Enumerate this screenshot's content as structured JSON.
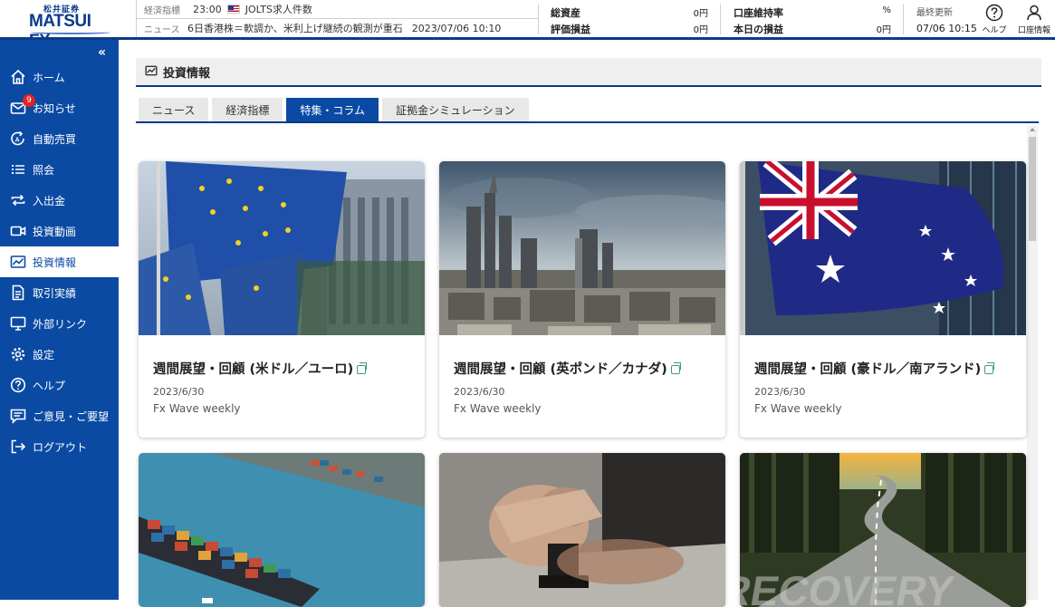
{
  "brand": {
    "top": "松井証券",
    "name": "MATSUI FX"
  },
  "ticker": {
    "row1": {
      "label": "経済指標",
      "time": "23:00",
      "text": "JOLTS求人件数"
    },
    "row2": {
      "label": "ニュース",
      "text": "6日香港株＝軟調か、米利上げ継続の観測が重石",
      "timestamp": "2023/07/06 10:10"
    }
  },
  "stats": {
    "total_assets": {
      "label": "総資産",
      "value": "0円"
    },
    "valuation": {
      "label": "評価損益",
      "value": "0円"
    },
    "margin_rate": {
      "label": "口座維持率",
      "value": "%"
    },
    "today_pl": {
      "label": "本日の損益",
      "value": "0円"
    }
  },
  "last_update": {
    "label": "最終更新",
    "time": "07/06 10:15"
  },
  "header_buttons": {
    "help": "ヘルプ",
    "account": "口座情報"
  },
  "sidebar": {
    "collapse": "«",
    "badge": "9",
    "items": [
      {
        "label": "ホーム"
      },
      {
        "label": "お知らせ"
      },
      {
        "label": "自動売買"
      },
      {
        "label": "照会"
      },
      {
        "label": "入出金"
      },
      {
        "label": "投資動画"
      },
      {
        "label": "投資情報"
      },
      {
        "label": "取引実績"
      },
      {
        "label": "外部リンク"
      },
      {
        "label": "設定"
      },
      {
        "label": "ヘルプ"
      },
      {
        "label": "ご意見・ご要望"
      },
      {
        "label": "ログアウト"
      }
    ]
  },
  "page": {
    "title": "投資情報"
  },
  "tabs": [
    {
      "label": "ニュース"
    },
    {
      "label": "経済指標"
    },
    {
      "label": "特集・コラム"
    },
    {
      "label": "証拠金シミュレーション"
    }
  ],
  "cards": [
    {
      "title": "週間展望・回顧 (米ドル／ユーロ)",
      "date": "2023/6/30",
      "source": "Fx Wave weekly"
    },
    {
      "title": "週間展望・回顧 (英ポンド／カナダ)",
      "date": "2023/6/30",
      "source": "Fx Wave weekly"
    },
    {
      "title": "週間展望・回顧 (豪ドル／南アランド)",
      "date": "2023/6/30",
      "source": "Fx Wave weekly"
    },
    {
      "title": "",
      "date": "",
      "source": ""
    },
    {
      "title": "",
      "date": "",
      "source": ""
    },
    {
      "title": "",
      "date": "",
      "source": ""
    }
  ],
  "recovery_text": "RECOVERY"
}
